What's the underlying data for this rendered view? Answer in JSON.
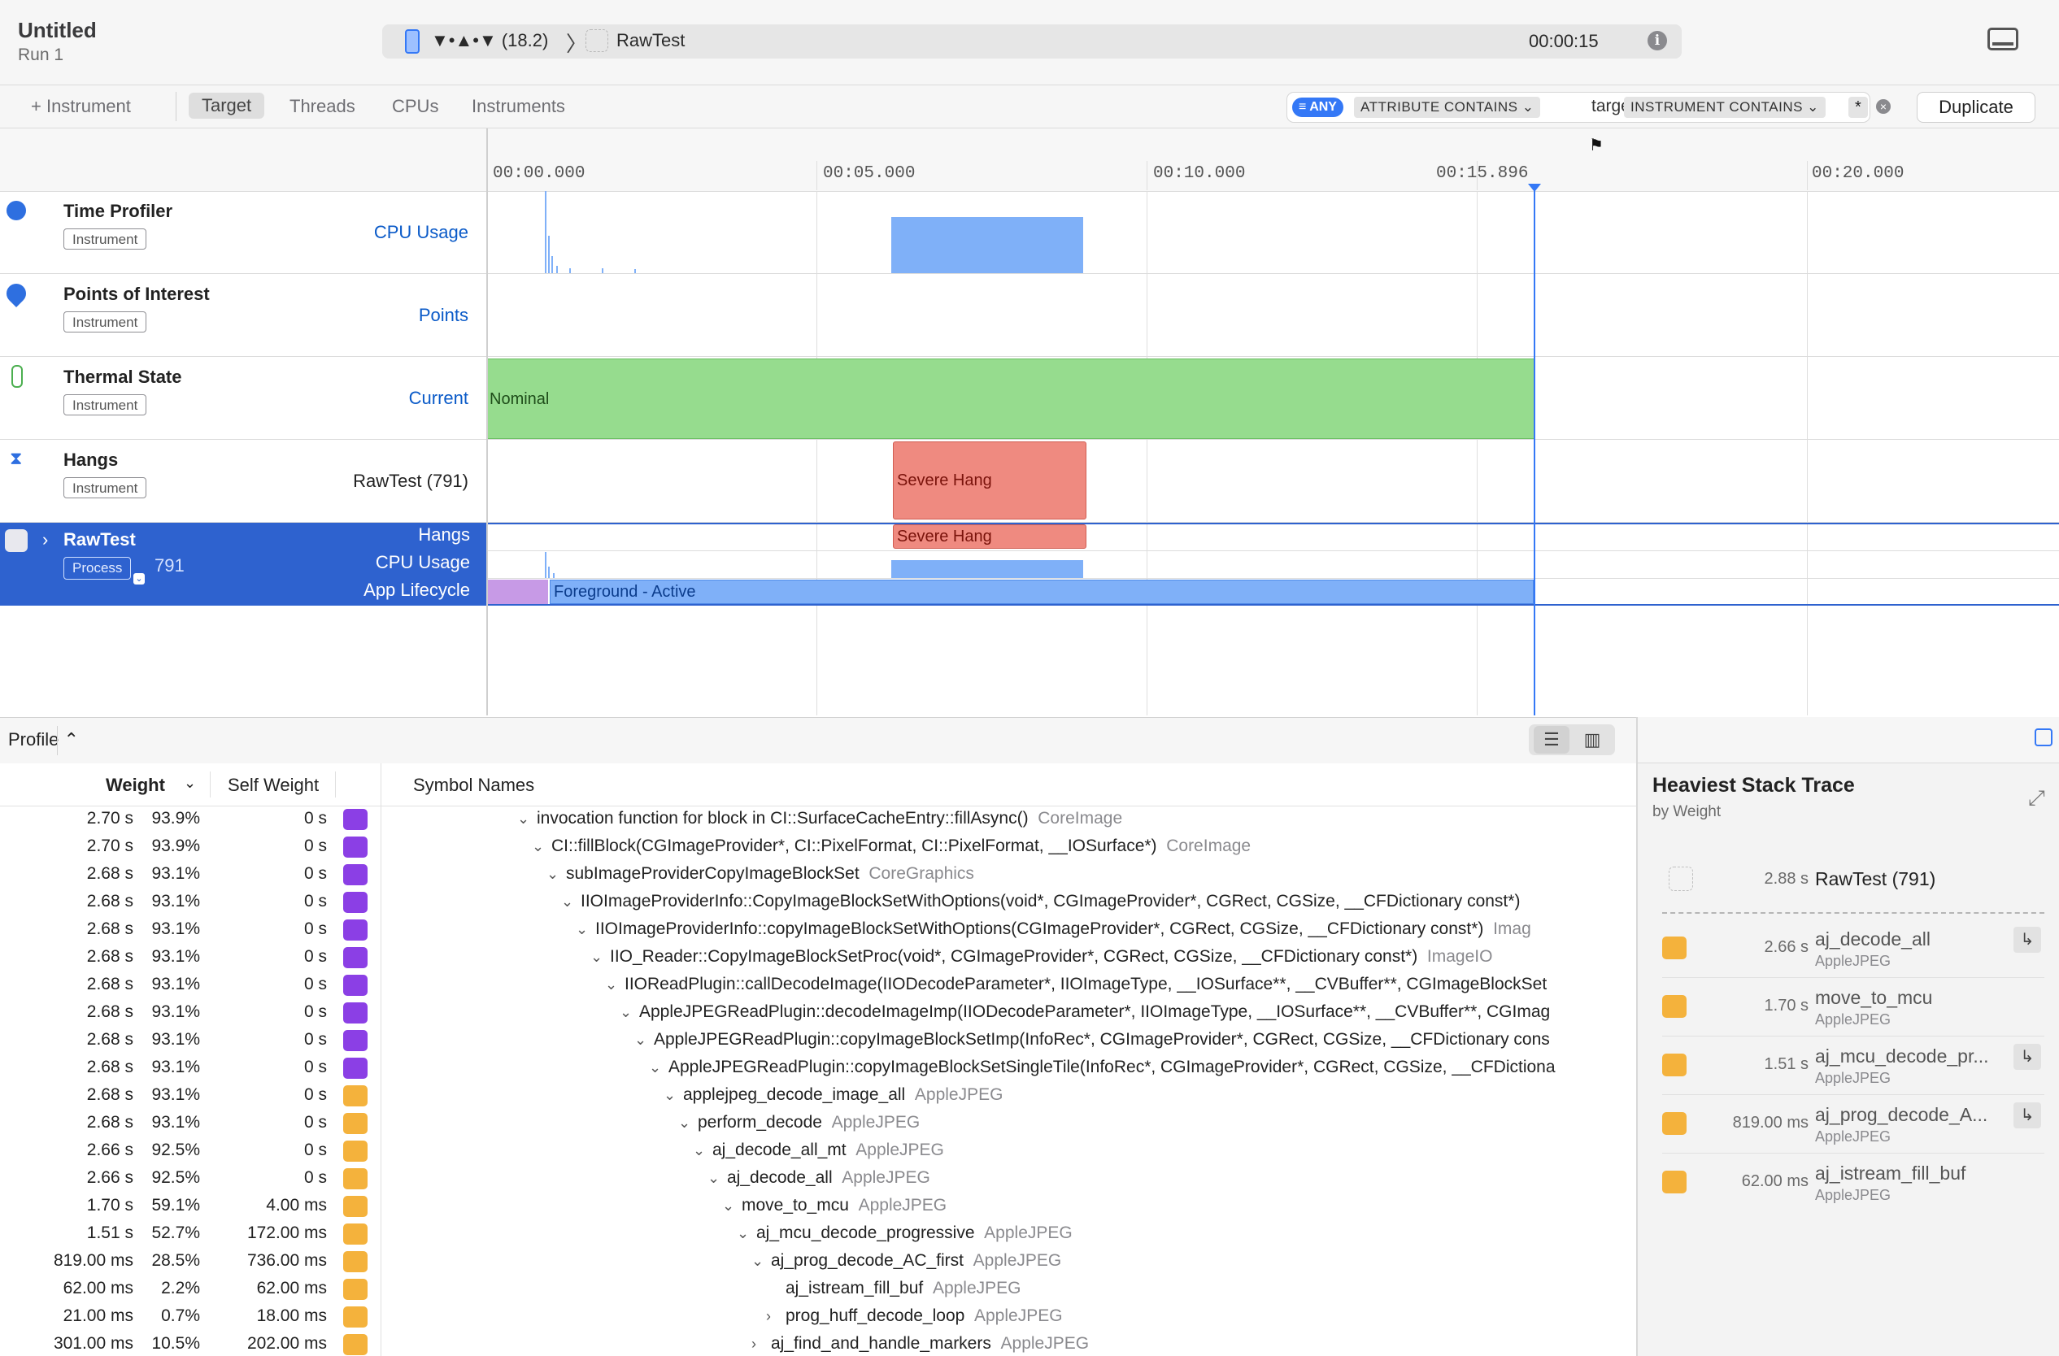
{
  "window": {
    "title": "Untitled",
    "subtitle": "Run 1"
  },
  "scheme": {
    "device": "▼•▲•▼ (18.2)",
    "separator": "〉",
    "app": "RawTest",
    "elapsed": "00:00:15"
  },
  "toolbar": {
    "add_instrument": "+ Instrument",
    "tabs": [
      "Target",
      "Threads",
      "CPUs",
      "Instruments"
    ],
    "filter": {
      "any": "ANY",
      "token1": "ATTRIBUTE CONTAINS ⌄",
      "token1_value": "target",
      "token2": "INSTRUMENT CONTAINS ⌄",
      "token2_value": "*"
    },
    "duplicate": "Duplicate"
  },
  "ruler": {
    "ticks": [
      "00:00.000",
      "00:05.000",
      "00:10.000",
      "00:15.896",
      "00:20.000"
    ]
  },
  "tracks": [
    {
      "name": "Time Profiler",
      "badge": "Instrument",
      "detail": "CPU Usage"
    },
    {
      "name": "Points of Interest",
      "badge": "Instrument",
      "detail": "Points"
    },
    {
      "name": "Thermal State",
      "badge": "Instrument",
      "detail": "Current",
      "bar_label": "Nominal"
    },
    {
      "name": "Hangs",
      "badge": "Instrument",
      "detail": "RawTest (791)",
      "bar_label": "Severe Hang"
    }
  ],
  "process": {
    "name": "RawTest",
    "badge": "Process",
    "pid": "791",
    "lanes": [
      "Hangs",
      "CPU Usage",
      "App Lifecycle"
    ],
    "hang_label": "Severe Hang",
    "lifecycle_label": "Foreground - Active"
  },
  "profile": {
    "mode": "Profile ⌃",
    "columns": {
      "weight": "Weight",
      "self": "Self Weight",
      "symbol": "Symbol Names"
    },
    "rows": [
      {
        "w": "2.70 s",
        "p": "93.9%",
        "s": "0 s",
        "c": "purple",
        "ind": 0,
        "t": "⌄",
        "sym": "invocation function for block in CI::SurfaceCacheEntry::fillAsync()",
        "lib": "CoreImage"
      },
      {
        "w": "2.70 s",
        "p": "93.9%",
        "s": "0 s",
        "c": "purple",
        "ind": 1,
        "t": "⌄",
        "sym": "CI::fillBlock(CGImageProvider*, CI::PixelFormat, CI::PixelFormat, __IOSurface*)",
        "lib": "CoreImage"
      },
      {
        "w": "2.68 s",
        "p": "93.1%",
        "s": "0 s",
        "c": "purple",
        "ind": 2,
        "t": "⌄",
        "sym": "subImageProviderCopyImageBlockSet",
        "lib": "CoreGraphics"
      },
      {
        "w": "2.68 s",
        "p": "93.1%",
        "s": "0 s",
        "c": "purple",
        "ind": 3,
        "t": "⌄",
        "sym": "IIOImageProviderInfo::CopyImageBlockSetWithOptions(void*, CGImageProvider*, CGRect, CGSize, __CFDictionary const*)",
        "lib": ""
      },
      {
        "w": "2.68 s",
        "p": "93.1%",
        "s": "0 s",
        "c": "purple",
        "ind": 4,
        "t": "⌄",
        "sym": "IIOImageProviderInfo::copyImageBlockSetWithOptions(CGImageProvider*, CGRect, CGSize, __CFDictionary const*)",
        "lib": "Imag"
      },
      {
        "w": "2.68 s",
        "p": "93.1%",
        "s": "0 s",
        "c": "purple",
        "ind": 5,
        "t": "⌄",
        "sym": "IIO_Reader::CopyImageBlockSetProc(void*, CGImageProvider*, CGRect, CGSize, __CFDictionary const*)",
        "lib": "ImageIO"
      },
      {
        "w": "2.68 s",
        "p": "93.1%",
        "s": "0 s",
        "c": "purple",
        "ind": 6,
        "t": "⌄",
        "sym": "IIOReadPlugin::callDecodeImage(IIODecodeParameter*, IIOImageType, __IOSurface**, __CVBuffer**, CGImageBlockSet",
        "lib": ""
      },
      {
        "w": "2.68 s",
        "p": "93.1%",
        "s": "0 s",
        "c": "purple",
        "ind": 7,
        "t": "⌄",
        "sym": "AppleJPEGReadPlugin::decodeImageImp(IIODecodeParameter*, IIOImageType, __IOSurface**, __CVBuffer**, CGImag",
        "lib": ""
      },
      {
        "w": "2.68 s",
        "p": "93.1%",
        "s": "0 s",
        "c": "purple",
        "ind": 8,
        "t": "⌄",
        "sym": "AppleJPEGReadPlugin::copyImageBlockSetImp(InfoRec*, CGImageProvider*, CGRect, CGSize, __CFDictionary cons",
        "lib": ""
      },
      {
        "w": "2.68 s",
        "p": "93.1%",
        "s": "0 s",
        "c": "purple",
        "ind": 9,
        "t": "⌄",
        "sym": "AppleJPEGReadPlugin::copyImageBlockSetSingleTile(InfoRec*, CGImageProvider*, CGRect, CGSize, __CFDictiona",
        "lib": ""
      },
      {
        "w": "2.68 s",
        "p": "93.1%",
        "s": "0 s",
        "c": "orange",
        "ind": 10,
        "t": "⌄",
        "sym": "applejpeg_decode_image_all",
        "lib": "AppleJPEG"
      },
      {
        "w": "2.68 s",
        "p": "93.1%",
        "s": "0 s",
        "c": "orange",
        "ind": 11,
        "t": "⌄",
        "sym": "perform_decode",
        "lib": "AppleJPEG"
      },
      {
        "w": "2.66 s",
        "p": "92.5%",
        "s": "0 s",
        "c": "orange",
        "ind": 12,
        "t": "⌄",
        "sym": "aj_decode_all_mt",
        "lib": "AppleJPEG"
      },
      {
        "w": "2.66 s",
        "p": "92.5%",
        "s": "0 s",
        "c": "orange",
        "ind": 13,
        "t": "⌄",
        "sym": "aj_decode_all",
        "lib": "AppleJPEG"
      },
      {
        "w": "1.70 s",
        "p": "59.1%",
        "s": "4.00 ms",
        "c": "orange",
        "ind": 14,
        "t": "⌄",
        "sym": "move_to_mcu",
        "lib": "AppleJPEG"
      },
      {
        "w": "1.51 s",
        "p": "52.7%",
        "s": "172.00 ms",
        "c": "orange",
        "ind": 15,
        "t": "⌄",
        "sym": "aj_mcu_decode_progressive",
        "lib": "AppleJPEG"
      },
      {
        "w": "819.00 ms",
        "p": "28.5%",
        "s": "736.00 ms",
        "c": "orange",
        "ind": 16,
        "t": "⌄",
        "sym": "aj_prog_decode_AC_first",
        "lib": "AppleJPEG"
      },
      {
        "w": "62.00 ms",
        "p": "2.2%",
        "s": "62.00 ms",
        "c": "orange",
        "ind": 17,
        "t": "",
        "sym": "aj_istream_fill_buf",
        "lib": "AppleJPEG"
      },
      {
        "w": "21.00 ms",
        "p": "0.7%",
        "s": "18.00 ms",
        "c": "orange",
        "ind": 17,
        "t": "›",
        "sym": "prog_huff_decode_loop",
        "lib": "AppleJPEG"
      },
      {
        "w": "301.00 ms",
        "p": "10.5%",
        "s": "202.00 ms",
        "c": "orange",
        "ind": 16,
        "t": "›",
        "sym": "aj_find_and_handle_markers",
        "lib": "AppleJPEG"
      }
    ]
  },
  "inspector": {
    "title": "Heaviest Stack Trace",
    "subtitle": "by Weight",
    "root": {
      "weight": "2.88 s",
      "name": "RawTest (791)"
    },
    "frames": [
      {
        "weight": "2.66 s",
        "name": "aj_decode_all",
        "lib": "AppleJPEG",
        "jump": true
      },
      {
        "weight": "1.70 s",
        "name": "move_to_mcu",
        "lib": "AppleJPEG",
        "jump": false
      },
      {
        "weight": "1.51 s",
        "name": "aj_mcu_decode_pr...",
        "lib": "AppleJPEG",
        "jump": true
      },
      {
        "weight": "819.00 ms",
        "name": "aj_prog_decode_A...",
        "lib": "AppleJPEG",
        "jump": true
      },
      {
        "weight": "62.00 ms",
        "name": "aj_istream_fill_buf",
        "lib": "AppleJPEG",
        "jump": false
      }
    ]
  },
  "colors": {
    "accent": "#3478f6",
    "selection": "#2e62cf",
    "thermal": "#96dc8e",
    "hang": "#ef8a80",
    "cpu": "#7fb0f8",
    "instrument_purple": "#8b3fe5",
    "lib_orange": "#f4b23c"
  }
}
